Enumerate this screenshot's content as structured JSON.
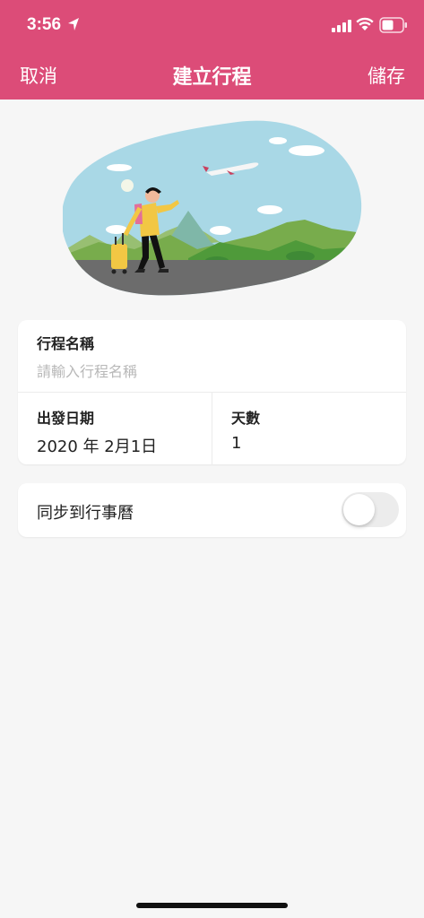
{
  "status_bar": {
    "time": "3:56",
    "icons": [
      "location-arrow-icon",
      "signal-icon",
      "wifi-icon",
      "battery-icon"
    ]
  },
  "nav": {
    "cancel_label": "取消",
    "title": "建立行程",
    "save_label": "儲存"
  },
  "trip_form": {
    "name_label": "行程名稱",
    "name_value": "",
    "name_placeholder": "請輸入行程名稱",
    "date_label": "出發日期",
    "date_value": "2020 年 2月1日",
    "days_label": "天數",
    "days_value": "1"
  },
  "sync": {
    "label": "同步到行事曆",
    "enabled": false
  },
  "colors": {
    "accent": "#dc4c78",
    "background": "#f6f6f6",
    "card": "#ffffff"
  }
}
